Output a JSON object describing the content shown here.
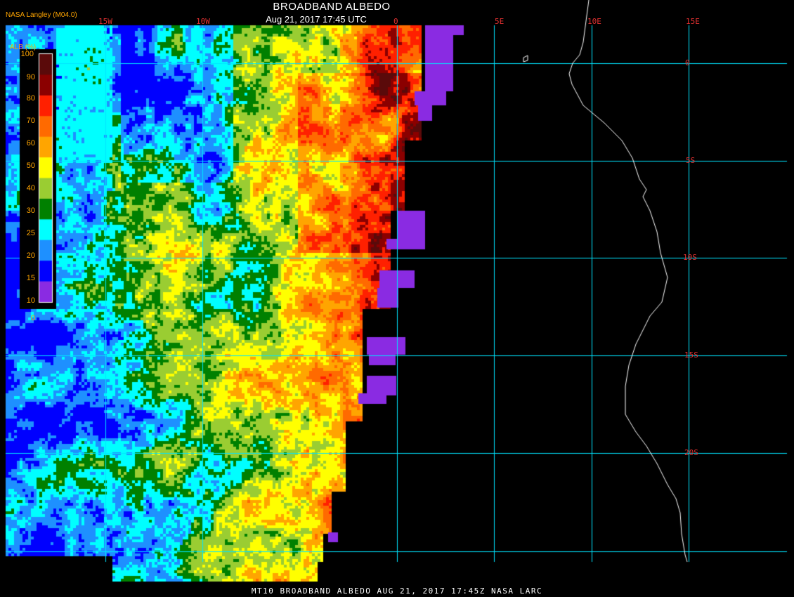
{
  "title": "BROADBAND ALBEDO",
  "datetime": "Aug 21, 2017 17:45 UTC",
  "credit": "NASA Langley (M04.0)",
  "footer": "MT10  BROADBAND ALBEDO  AUG 21, 2017 17:45Z  NASA LARC",
  "colorbar": {
    "label": "ALB (%)",
    "ticks": [
      "100",
      "90",
      "80",
      "70",
      "60",
      "50",
      "40",
      "30",
      "25",
      "20",
      "15",
      "10",
      "0"
    ],
    "colors": [
      "#5a0a0a",
      "#8b0000",
      "#ff2000",
      "#ff6a00",
      "#ffa500",
      "#ffff00",
      "#9acd32",
      "#008000",
      "#00ffff",
      "#1e90ff",
      "#0000ff",
      "#8a2be2"
    ]
  },
  "grid": {
    "longitudes": [
      "15W",
      "10W",
      "0",
      "5E",
      "10E",
      "15E"
    ],
    "latitudes": [
      "0",
      "5S",
      "10S",
      "15S",
      "20S"
    ],
    "line_color": "#00e5ff"
  }
}
